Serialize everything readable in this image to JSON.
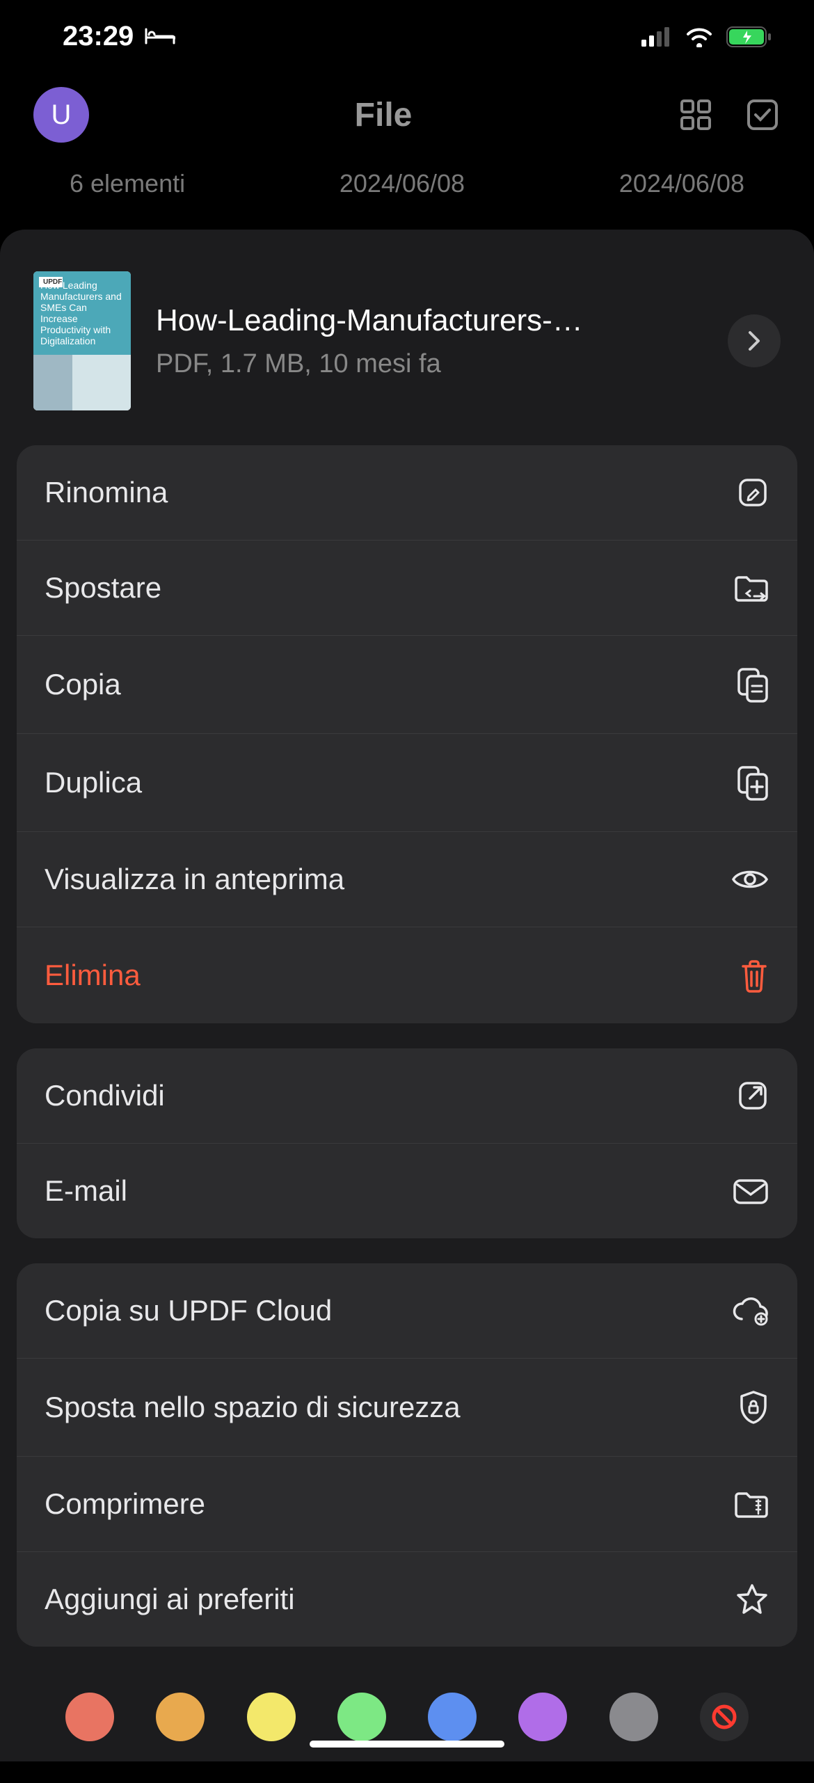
{
  "status": {
    "time": "23:29"
  },
  "nav": {
    "title": "File",
    "avatar_letter": "U"
  },
  "background": {
    "elements": "6 elementi",
    "date1": "2024/06/08",
    "date2": "2024/06/08"
  },
  "file": {
    "name": "How-Leading-Manufacturers-…",
    "meta": "PDF, 1.7 MB, 10 mesi fa",
    "thumb_badge": "UPDF",
    "thumb_title": "How Leading Manufacturers and SMEs Can Increase Productivity with Digitalization"
  },
  "menu_group1": [
    {
      "label": "Rinomina",
      "icon": "edit"
    },
    {
      "label": "Spostare",
      "icon": "move-folder"
    },
    {
      "label": "Copia",
      "icon": "copy"
    },
    {
      "label": "Duplica",
      "icon": "duplicate"
    },
    {
      "label": "Visualizza in anteprima",
      "icon": "eye"
    },
    {
      "label": "Elimina",
      "icon": "trash",
      "danger": true
    }
  ],
  "menu_group2": [
    {
      "label": "Condividi",
      "icon": "share-ext"
    },
    {
      "label": "E-mail",
      "icon": "mail"
    }
  ],
  "menu_group3": [
    {
      "label": "Copia su UPDF Cloud",
      "icon": "cloud-add"
    },
    {
      "label": "Sposta nello spazio di sicurezza",
      "icon": "shield-lock"
    },
    {
      "label": "Comprimere",
      "icon": "archive"
    },
    {
      "label": "Aggiungi ai preferiti",
      "icon": "star"
    }
  ],
  "colors": [
    "#e87462",
    "#e8a94e",
    "#f3e86b",
    "#7de884",
    "#5d8ff0",
    "#b06de8",
    "#8a8a8e"
  ]
}
